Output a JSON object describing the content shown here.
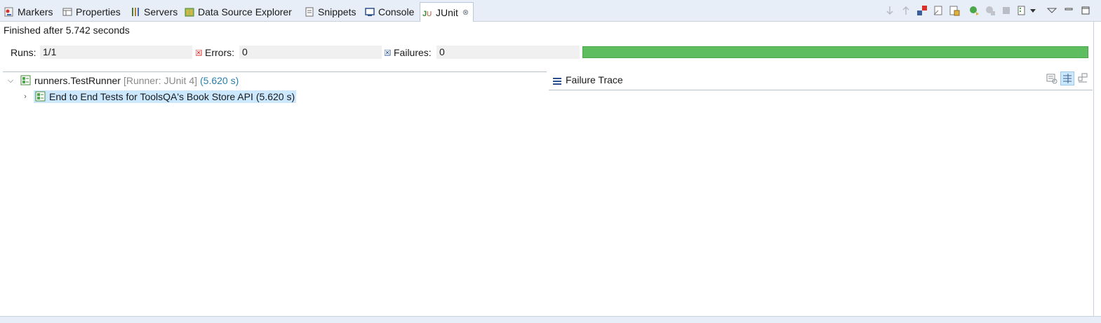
{
  "tabs": [
    {
      "label": "Markers",
      "icon": "markers-icon"
    },
    {
      "label": "Properties",
      "icon": "properties-icon"
    },
    {
      "label": "Servers",
      "icon": "servers-icon"
    },
    {
      "label": "Data Source Explorer",
      "icon": "data-source-explorer-icon"
    },
    {
      "label": "Snippets",
      "icon": "snippets-icon"
    },
    {
      "label": "Console",
      "icon": "console-icon"
    },
    {
      "label": "JUnit",
      "icon": "junit-icon",
      "active": true
    }
  ],
  "toolbar_icons": [
    "next-failure-icon",
    "previous-failure-icon",
    "failures-only-icon",
    "skipped-tests-icon",
    "scroll-lock-icon",
    "rerun-test-icon",
    "rerun-failed-first-icon",
    "stop-icon",
    "test-run-history-icon",
    "history-dropdown-icon",
    "view-menu-icon",
    "minimize-icon",
    "maximize-icon"
  ],
  "status": {
    "text": "Finished after 5.742 seconds"
  },
  "counters": {
    "runs_label": "Runs:",
    "runs_value": "1/1",
    "errors_label": "Errors:",
    "errors_value": "0",
    "failures_label": "Failures:",
    "failures_value": "0"
  },
  "progress": {
    "fraction": 1.0,
    "color": "#5ebd5e"
  },
  "tree": {
    "root": {
      "name": "runners.TestRunner",
      "runner": "[Runner: JUnit 4]",
      "time": "(5.620 s)"
    },
    "child": {
      "name": "End to End Tests for ToolsQA's Book Store API",
      "time": "(5.620 s)"
    }
  },
  "trace": {
    "title": "Failure Trace"
  },
  "colors": {
    "accent": "#2a7fa8",
    "selection": "#cce8ff",
    "progress_ok": "#5ebd5e",
    "error": "#d9302c",
    "failure": "#3b5f9a"
  }
}
